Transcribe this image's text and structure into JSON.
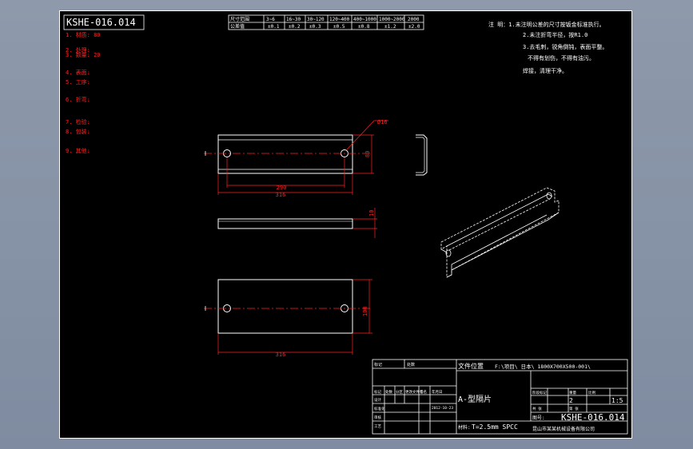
{
  "drawing": {
    "number": "KSHE-016.014",
    "part_name": "A-型隔片",
    "material": "T=2.5mm SPCC",
    "scale": "1:5",
    "quantity": "2",
    "file_path": "F:\\项目\\ 日本\\ 1800X700X500-001\\",
    "file_label": "文件位置",
    "company_note": "昆山市某某机械设备有限公司",
    "date": "2012-10-23"
  },
  "tolerance_table": {
    "row_labels": [
      "尺寸范围",
      "公差值"
    ],
    "ranges": [
      "3~6",
      "16~30",
      "30~120",
      "120~400",
      "400~1000",
      "1000~2000",
      "2000"
    ],
    "values": [
      "±0.1",
      "±0.2",
      "±0.3",
      "±0.5",
      "±0.8",
      "±1.2",
      "±2.0"
    ]
  },
  "notes_right": [
    "注  明：1.未注明公差的尺寸按钣金标准执行。",
    "2.未注折弯半径，按R1.0",
    "3.去毛刺，锐角倒钝，表面平整。",
    "不得有划伤，不得有油污。",
    "焊接，清理干净。"
  ],
  "notes_left": [
    "1. 材质:    80",
    "2. 处理:",
    "3. 数量:    20",
    "4. 表面:",
    "5. 工序:",
    "6. 折弯:",
    "7. 检验:",
    "8. 包装:",
    "9. 其他:"
  ],
  "dimensions": {
    "hole_diameter": "Ø16",
    "hole_spacing": "290",
    "overall_length": "316",
    "height": "80",
    "thickness": "10",
    "bottom_height": "100",
    "bottom_length": "316"
  },
  "title_block": {
    "labels": [
      "标记",
      "处数",
      "分区",
      "更改文件号",
      "签名",
      "年月日",
      "设计",
      "标准化",
      "审核",
      "工艺",
      "批准"
    ],
    "stage_labels": [
      "阶段标记",
      "重量",
      "比例"
    ],
    "sheet_label": "第 张",
    "total_label": "共 张",
    "material_label": "材料:",
    "number_label": "图号:"
  },
  "colors": {
    "sheet": "#000000",
    "line": "#ffffff",
    "dimension": "#ff2020",
    "viewport": "#8a96a6"
  }
}
